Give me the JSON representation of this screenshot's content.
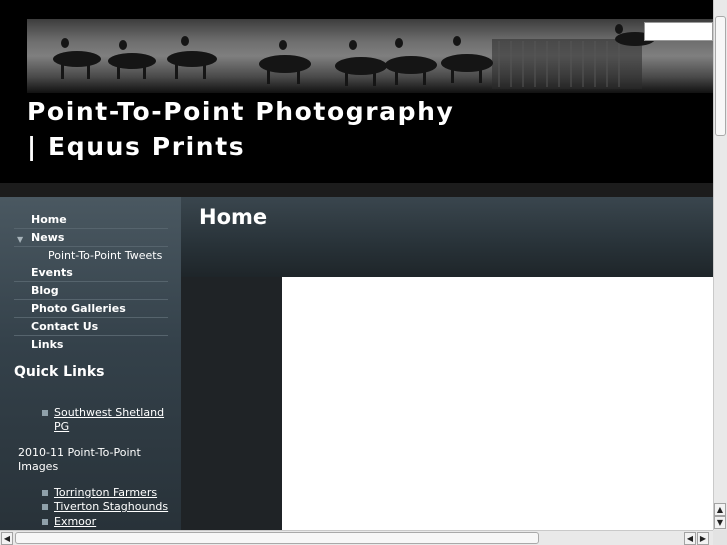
{
  "header": {
    "title_line1": "Point-To-Point Photography",
    "title_line2": "| Equus Prints"
  },
  "sidebar": {
    "nav": [
      {
        "label": "Home"
      },
      {
        "label": "News"
      },
      {
        "label": "Point-To-Point Tweets"
      },
      {
        "label": "Events"
      },
      {
        "label": "Blog"
      },
      {
        "label": "Photo Galleries"
      },
      {
        "label": "Contact Us"
      },
      {
        "label": "Links"
      }
    ],
    "quick_links_title": "Quick Links",
    "quick_links": [
      {
        "label": "Southwest Shetland PG"
      }
    ],
    "images_heading": "2010-11 Point-To-Point Images",
    "image_links": [
      {
        "label": "Torrington Farmers"
      },
      {
        "label": "Tiverton Staghounds"
      },
      {
        "label": "Exmoor"
      }
    ]
  },
  "main": {
    "page_title": "Home"
  },
  "colors": {
    "background": "#000000",
    "sidebar": "#3b4850",
    "content": "#ffffff"
  }
}
